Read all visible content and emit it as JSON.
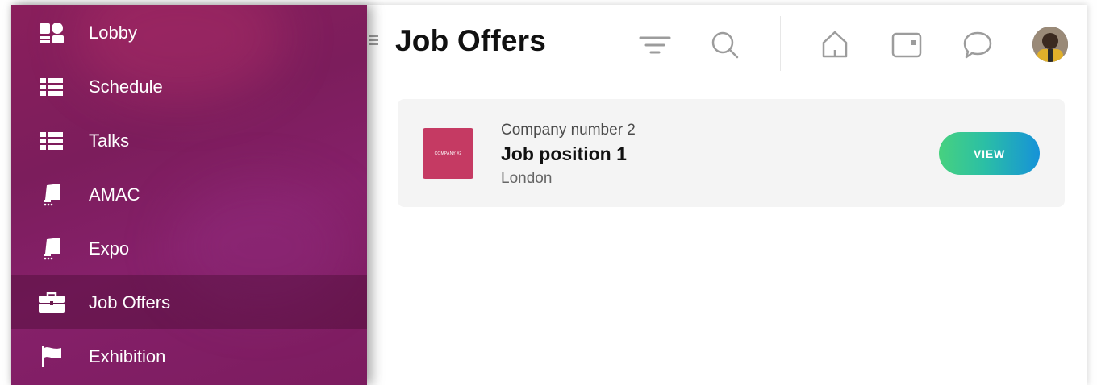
{
  "sidebar": {
    "items": [
      {
        "label": "Lobby",
        "icon": "lobby-icon"
      },
      {
        "label": "Schedule",
        "icon": "list-icon"
      },
      {
        "label": "Talks",
        "icon": "list-icon"
      },
      {
        "label": "AMAC",
        "icon": "stage-icon"
      },
      {
        "label": "Expo",
        "icon": "stage-icon"
      },
      {
        "label": "Job Offers",
        "icon": "briefcase-icon",
        "active": true
      },
      {
        "label": "Exhibition",
        "icon": "flag-icon"
      }
    ],
    "colors": {
      "background": "#7c1d5c",
      "active_overlay": "#4a0f34"
    }
  },
  "header": {
    "title": "Job Offers",
    "icons": [
      "filter-icon",
      "search-icon",
      "home-icon",
      "wallet-icon",
      "chat-icon"
    ]
  },
  "job_offer": {
    "logo_text": "COMPANY #2",
    "company": "Company number 2",
    "position": "Job position 1",
    "location": "London",
    "action_label": "VIEW",
    "logo_color": "#c53a63"
  }
}
